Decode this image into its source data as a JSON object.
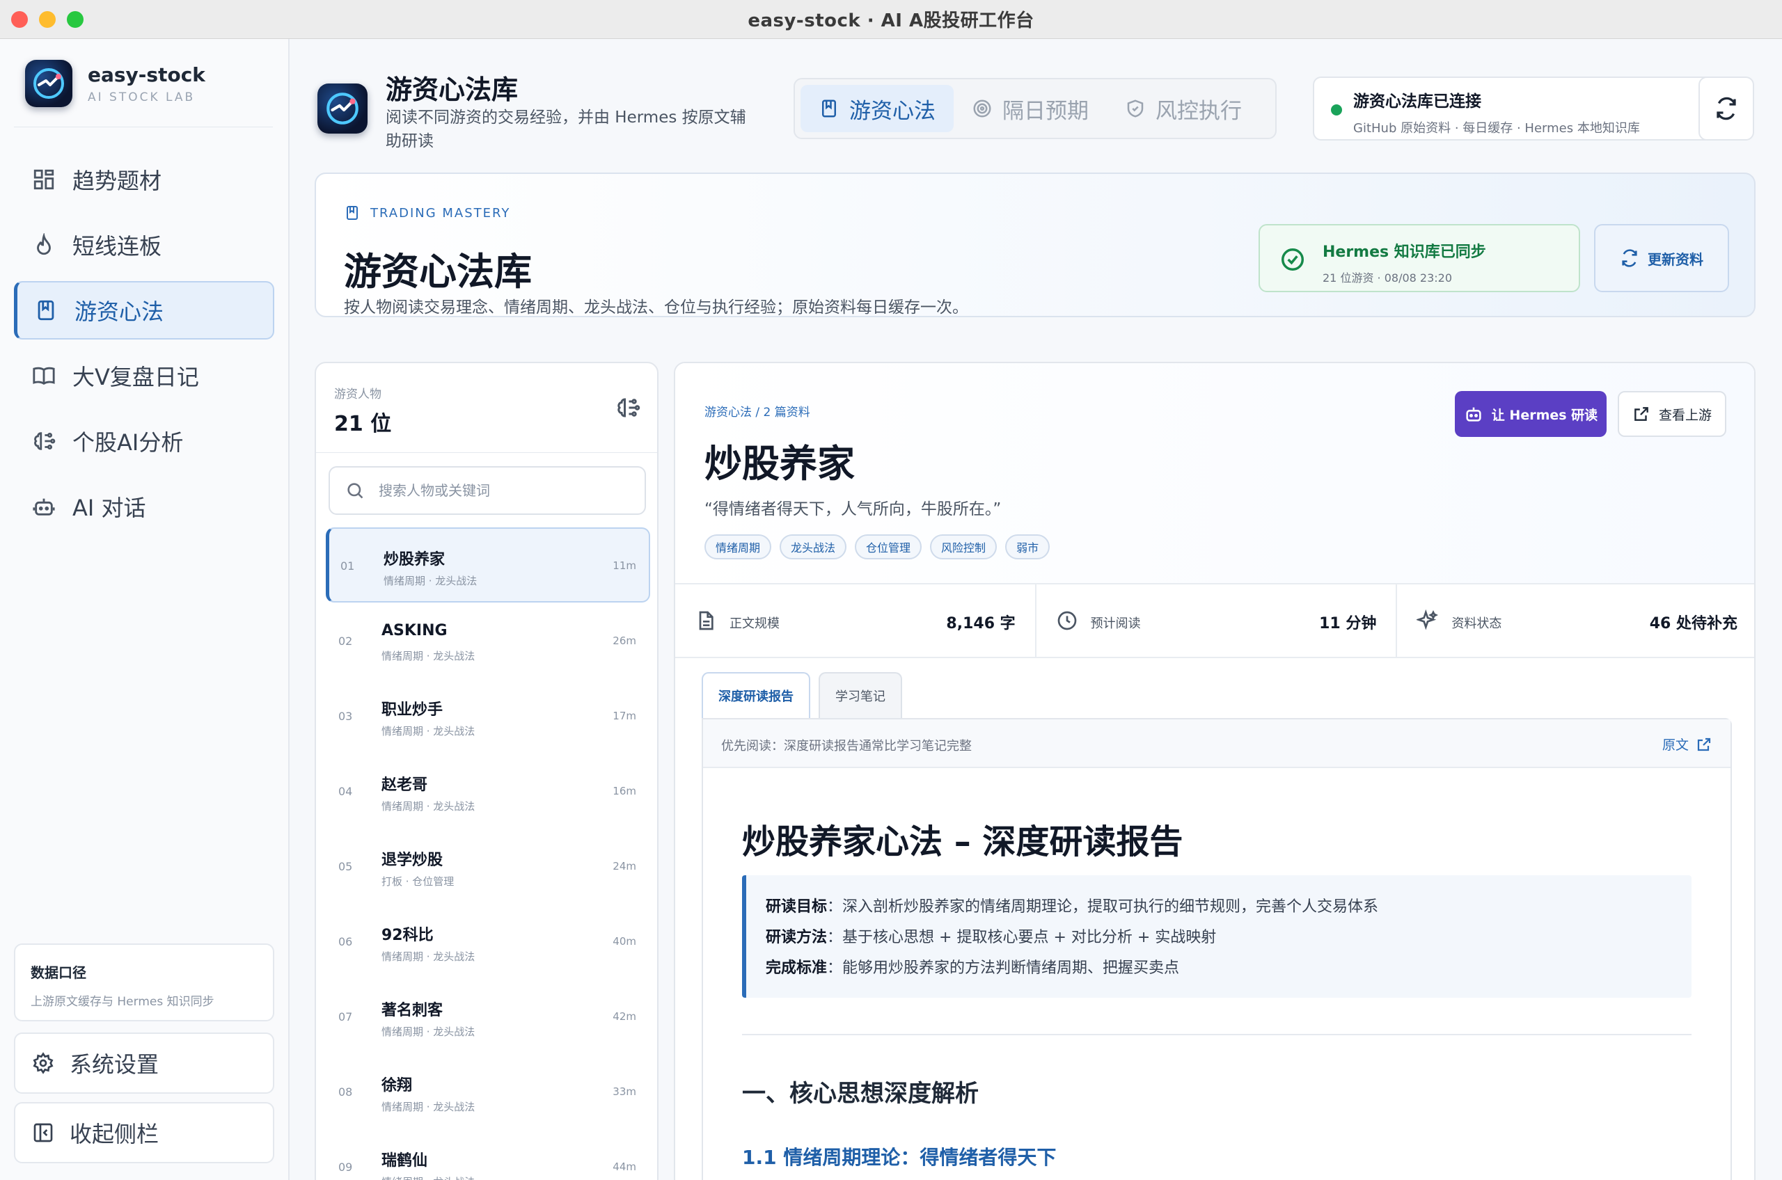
{
  "window": {
    "title": "easy-stock · AI A股投研工作台"
  },
  "brand": {
    "name": "easy-stock",
    "sub": "AI STOCK LAB"
  },
  "sidebar": {
    "items": [
      {
        "label": "趋势题材",
        "icon": "grid-icon"
      },
      {
        "label": "短线连板",
        "icon": "flame-icon"
      },
      {
        "label": "游资心法",
        "icon": "bookmark-book-icon",
        "active": true
      },
      {
        "label": "大V复盘日记",
        "icon": "open-book-icon"
      },
      {
        "label": "个股AI分析",
        "icon": "brain-icon"
      },
      {
        "label": "AI 对话",
        "icon": "robot-icon"
      }
    ],
    "data_card": {
      "title": "数据口径",
      "sub": "上游原文缓存与 Hermes 知识同步"
    },
    "settings_label": "系统设置",
    "collapse_label": "收起侧栏"
  },
  "header": {
    "title": "游资心法库",
    "sub": "阅读不同游资的交易经验，并由 Hermes 按原文辅助研读",
    "tabs": [
      {
        "label": "游资心法",
        "icon": "bookmark-book-icon",
        "active": true
      },
      {
        "label": "隔日预期",
        "icon": "target-icon"
      },
      {
        "label": "风控执行",
        "icon": "shield-icon"
      }
    ],
    "connection": {
      "title": "游资心法库已连接",
      "sub": "GitHub 原始资料 · 每日缓存 · Hermes 本地知识库",
      "status_color": "#1aa35a"
    }
  },
  "banner": {
    "kicker": "TRADING MASTERY",
    "title": "游资心法库",
    "sub": "按人物阅读交易理念、情绪周期、龙头战法、仓位与执行经验；原始资料每日缓存一次。",
    "sync_title": "Hermes 知识库已同步",
    "sync_sub": "21 位游资 · 08/08 23:20",
    "update_label": "更新资料"
  },
  "people": {
    "label": "游资人物",
    "count": "21 位",
    "search_placeholder": "搜索人物或关键词",
    "list": [
      {
        "num": "01",
        "name": "炒股养家",
        "tags": "情绪周期 · 龙头战法",
        "time": "11m",
        "active": true
      },
      {
        "num": "02",
        "name": "ASKING",
        "tags": "情绪周期 · 龙头战法",
        "time": "26m"
      },
      {
        "num": "03",
        "name": "职业炒手",
        "tags": "情绪周期 · 龙头战法",
        "time": "17m"
      },
      {
        "num": "04",
        "name": "赵老哥",
        "tags": "情绪周期 · 龙头战法",
        "time": "16m"
      },
      {
        "num": "05",
        "name": "退学炒股",
        "tags": "打板 · 仓位管理",
        "time": "24m"
      },
      {
        "num": "06",
        "name": "92科比",
        "tags": "情绪周期 · 龙头战法",
        "time": "40m"
      },
      {
        "num": "07",
        "name": "著名刺客",
        "tags": "情绪周期 · 龙头战法",
        "time": "42m"
      },
      {
        "num": "08",
        "name": "徐翔",
        "tags": "情绪周期 · 龙头战法",
        "time": "33m"
      },
      {
        "num": "09",
        "name": "瑞鹤仙",
        "tags": "情绪周期 · 龙头战法",
        "time": "44m"
      }
    ]
  },
  "detail": {
    "crumb": "游资心法 / 2 篇资料",
    "title": "炒股养家",
    "quote": "“得情绪者得天下，人气所向，牛股所在。”",
    "tags": [
      "情绪周期",
      "龙头战法",
      "仓位管理",
      "风险控制",
      "弱市"
    ],
    "hermes_label": "让 Hermes 研读",
    "upstream_label": "查看上游",
    "stats": [
      {
        "label": "正文规模",
        "value": "8,146 字",
        "icon": "document-icon"
      },
      {
        "label": "预计阅读",
        "value": "11 分钟",
        "icon": "clock-icon"
      },
      {
        "label": "资料状态",
        "value": "46 处待补充",
        "icon": "sparkle-icon"
      }
    ],
    "tabs": [
      {
        "label": "深度研读报告",
        "active": true
      },
      {
        "label": "学习笔记"
      }
    ],
    "reader": {
      "hint": "优先阅读：深度研读报告通常比学习笔记完整",
      "source_label": "原文",
      "h1": "炒股养家心法 – 深度研读报告",
      "box": [
        {
          "key": "研读目标",
          "text": "深入剖析炒股养家的情绪周期理论，提取可执行的细节规则，完善个人交易体系"
        },
        {
          "key": "研读方法",
          "text": "基于核心思想 + 提取核心要点 + 对比分析 + 实战映射"
        },
        {
          "key": "完成标准",
          "text": "能够用炒股养家的方法判断情绪周期、把握买卖点"
        }
      ],
      "h2": "一、核心思想深度解析",
      "h3": "1.1 情绪周期理论：得情绪者得天下"
    }
  }
}
